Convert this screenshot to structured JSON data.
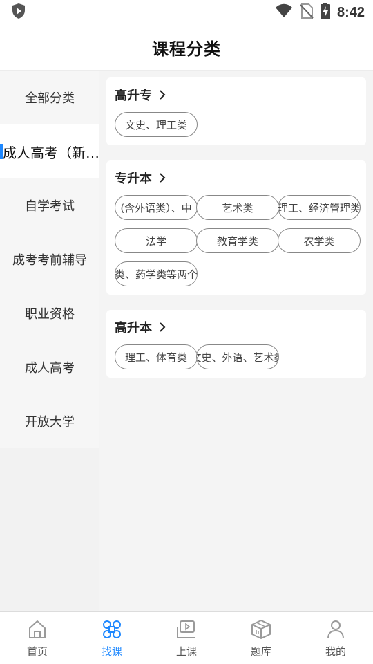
{
  "status_bar": {
    "time": "8:42"
  },
  "header": {
    "title": "课程分类"
  },
  "sidebar": {
    "items": [
      {
        "label": "全部分类"
      },
      {
        "label": "成人高考（新…"
      },
      {
        "label": "自学考试"
      },
      {
        "label": "成考考前辅导"
      },
      {
        "label": "职业资格"
      },
      {
        "label": "成人高考"
      },
      {
        "label": "开放大学"
      }
    ]
  },
  "sections": [
    {
      "title": "高升专",
      "tags": [
        "文史、理工类"
      ]
    },
    {
      "title": "专升本",
      "tags": [
        "(含外语类）、中",
        "艺术类",
        "理工、经济管理类",
        "法学",
        "教育学类",
        "农学类",
        "类、药学类等两个"
      ]
    },
    {
      "title": "高升本",
      "tags": [
        "理工、体育类",
        "文史、外语、艺术类"
      ]
    }
  ],
  "bottom_nav": {
    "items": [
      {
        "label": "首页",
        "icon": "home-icon"
      },
      {
        "label": "找课",
        "icon": "find-course-icon"
      },
      {
        "label": "上课",
        "icon": "class-icon"
      },
      {
        "label": "题库",
        "icon": "question-bank-icon"
      },
      {
        "label": "我的",
        "icon": "profile-icon"
      }
    ]
  },
  "colors": {
    "accent": "#1e88ff",
    "inactive_icon": "#9a9a9a"
  }
}
